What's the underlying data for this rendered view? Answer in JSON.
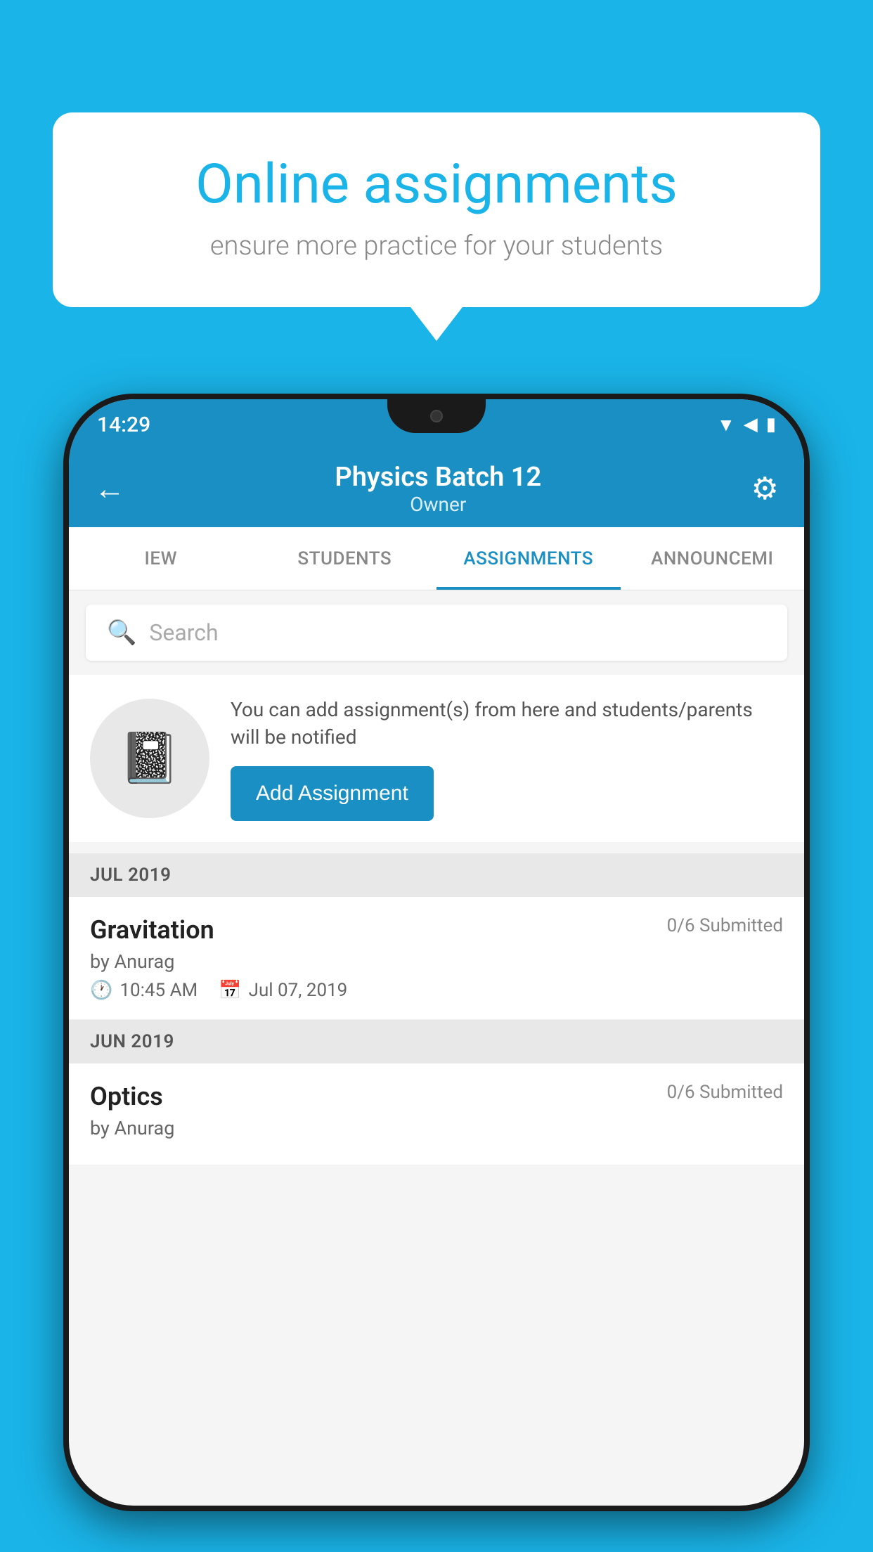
{
  "background_color": "#1ab4e8",
  "speech_bubble": {
    "title": "Online assignments",
    "subtitle": "ensure more practice for your students"
  },
  "status_bar": {
    "time": "14:29",
    "signal_icon": "▲",
    "wifi_icon": "▼",
    "battery_icon": "▮"
  },
  "app_bar": {
    "title": "Physics Batch 12",
    "subtitle": "Owner",
    "back_icon": "←",
    "settings_icon": "⚙"
  },
  "tabs": [
    {
      "label": "IEW",
      "active": false
    },
    {
      "label": "STUDENTS",
      "active": false
    },
    {
      "label": "ASSIGNMENTS",
      "active": true
    },
    {
      "label": "ANNOUNCEMI",
      "active": false
    }
  ],
  "search": {
    "placeholder": "Search"
  },
  "promo": {
    "description": "You can add assignment(s) from here and students/parents will be notified",
    "button_label": "Add Assignment"
  },
  "sections": [
    {
      "label": "JUL 2019",
      "assignments": [
        {
          "title": "Gravitation",
          "submitted": "0/6 Submitted",
          "by": "by Anurag",
          "time": "10:45 AM",
          "date": "Jul 07, 2019"
        }
      ]
    },
    {
      "label": "JUN 2019",
      "assignments": [
        {
          "title": "Optics",
          "submitted": "0/6 Submitted",
          "by": "by Anurag",
          "time": "",
          "date": ""
        }
      ]
    }
  ]
}
